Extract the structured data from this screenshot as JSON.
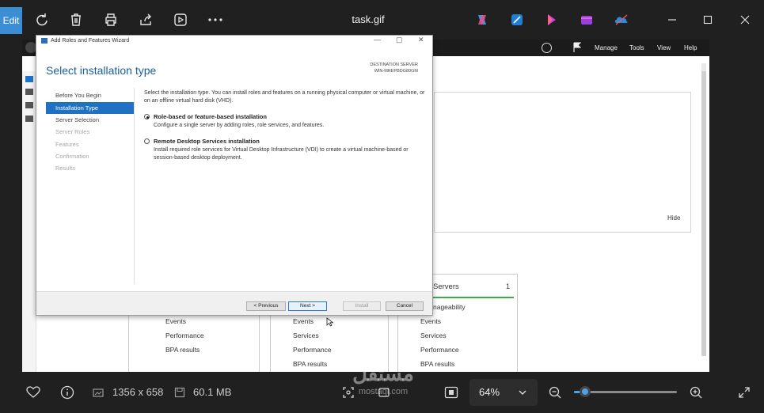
{
  "app": {
    "edit_label": "Edit",
    "file_name": "task.gif"
  },
  "image_info": {
    "dimensions": "1356 x 658",
    "file_size": "60.1 MB",
    "zoom": "64%",
    "zoom_fraction": 0.11
  },
  "server_manager": {
    "menu": [
      "Manage",
      "Tools",
      "View",
      "Help"
    ],
    "hide_label": "Hide",
    "tiles": [
      {
        "items": [
          "Events",
          "Performance",
          "BPA results"
        ]
      },
      {
        "items": [
          "Events",
          "Services",
          "Performance",
          "BPA results"
        ]
      },
      {
        "header": "Servers",
        "count": "1",
        "sub": "nageability",
        "items": [
          "Events",
          "Services",
          "Performance",
          "BPA results"
        ]
      }
    ]
  },
  "wizard": {
    "window_title": "Add Roles and Features Wizard",
    "heading": "Select installation type",
    "destination_label": "DESTINATION SERVER",
    "destination_server": "WIN-MREPBDG80GM",
    "nav": [
      {
        "label": "Before You Begin",
        "state": "normal"
      },
      {
        "label": "Installation Type",
        "state": "active"
      },
      {
        "label": "Server Selection",
        "state": "normal"
      },
      {
        "label": "Server Roles",
        "state": "disabled"
      },
      {
        "label": "Features",
        "state": "disabled"
      },
      {
        "label": "Confirmation",
        "state": "disabled"
      },
      {
        "label": "Results",
        "state": "disabled"
      }
    ],
    "intro": "Select the installation type. You can install roles and features on a running physical computer or virtual machine, or on an offline virtual hard disk (VHD).",
    "options": [
      {
        "title": "Role-based or feature-based installation",
        "desc": "Configure a single server by adding roles, role services, and features.",
        "selected": true
      },
      {
        "title": "Remote Desktop Services installation",
        "desc": "Install required role services for Virtual Desktop Infrastructure (VDI) to create a virtual machine-based or session-based desktop deployment.",
        "selected": false
      }
    ],
    "buttons": {
      "previous": "< Previous",
      "next": "Next >",
      "install": "Install",
      "cancel": "Cancel"
    }
  },
  "watermark": {
    "arabic": "مستقل",
    "latin": "mostaql.com"
  },
  "colors": {
    "accent": "#3b8ed4",
    "wizard_heading": "#1a5d9c",
    "nav_active": "#1f72c3",
    "slider": "#4aa3e8"
  }
}
